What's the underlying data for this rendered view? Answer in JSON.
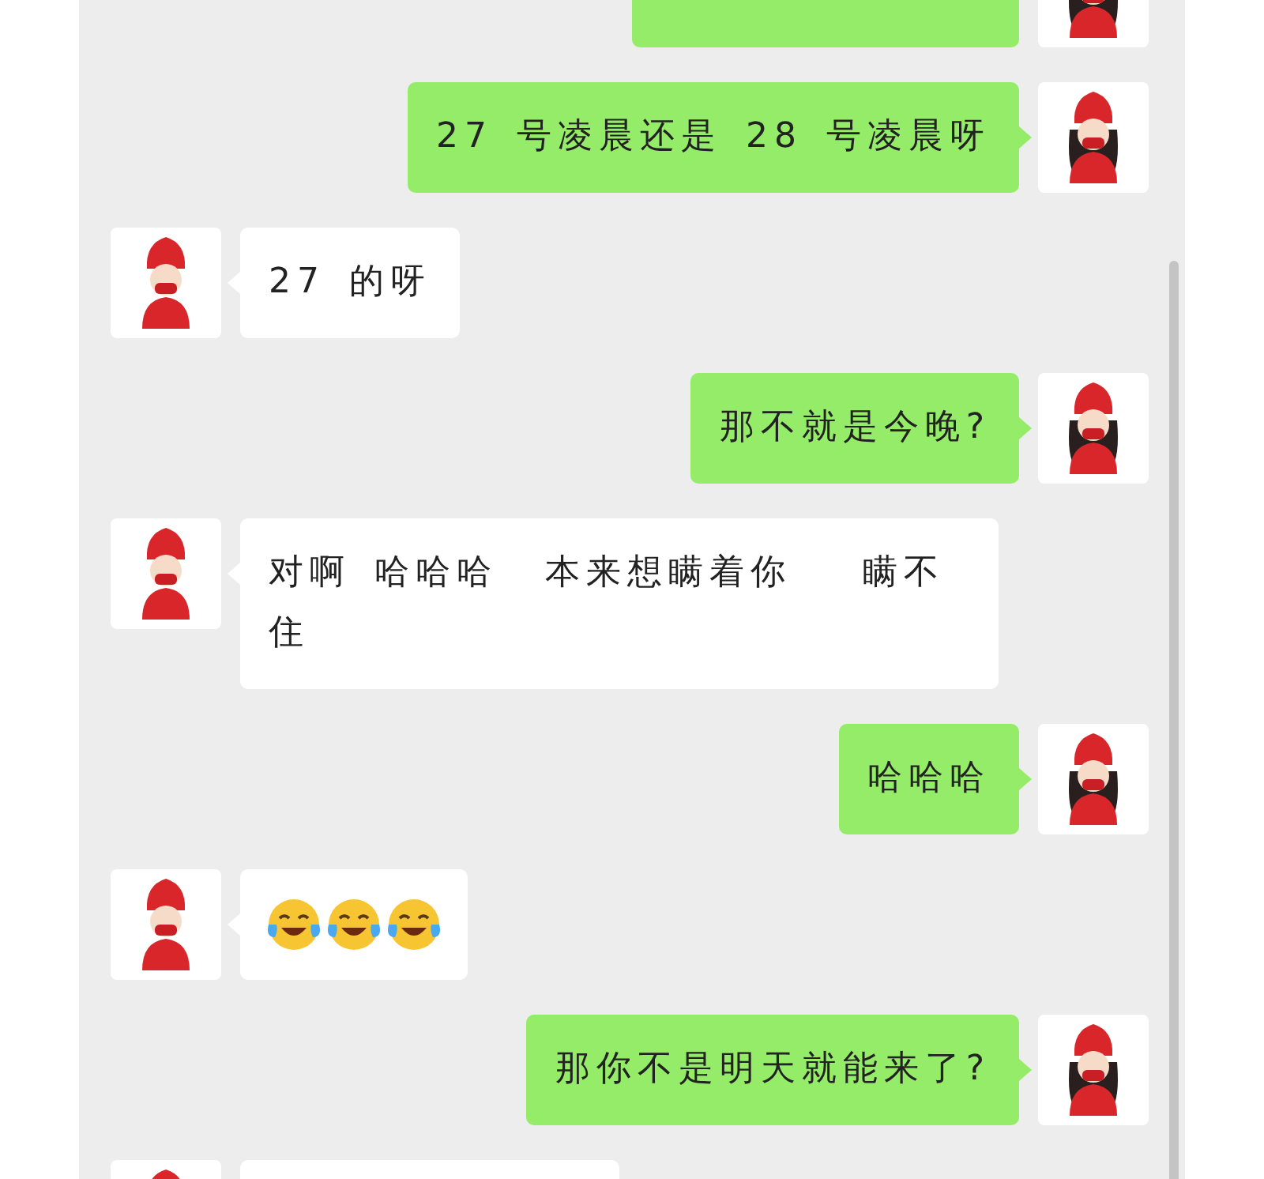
{
  "messages": [
    {
      "outgoing": true,
      "kind": "cut"
    },
    {
      "outgoing": true,
      "kind": "text",
      "text": "27 号凌晨还是 28 号凌晨呀"
    },
    {
      "outgoing": false,
      "kind": "text",
      "text": "27 的呀"
    },
    {
      "outgoing": true,
      "kind": "text",
      "text": "那不就是今晚?"
    },
    {
      "outgoing": false,
      "kind": "text",
      "text": "对啊 哈哈哈  本来想瞒着你   瞒不住"
    },
    {
      "outgoing": true,
      "kind": "text",
      "text": "哈哈哈"
    },
    {
      "outgoing": false,
      "kind": "emoji",
      "items": [
        {
          "kind": "laugh-cry"
        },
        {
          "kind": "laugh-cry"
        },
        {
          "kind": "laugh-cry"
        }
      ]
    },
    {
      "outgoing": true,
      "kind": "text",
      "text": "那你不是明天就能来了?"
    },
    {
      "outgoing": false,
      "kind": "cut"
    }
  ]
}
